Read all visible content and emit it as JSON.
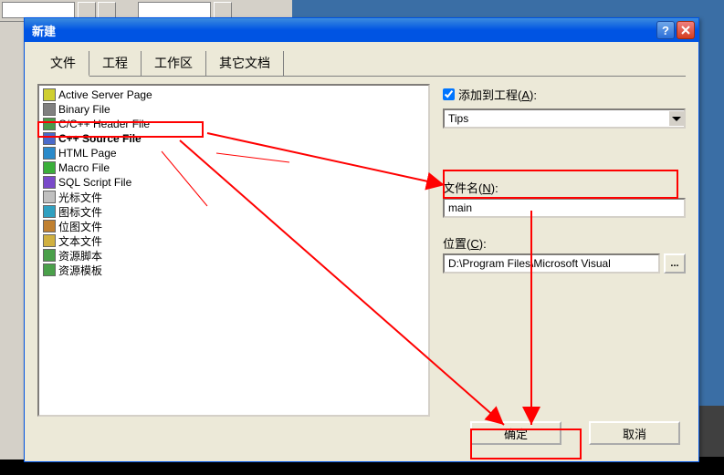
{
  "dialog": {
    "title": "新建",
    "tabs": [
      "文件",
      "工程",
      "工作区",
      "其它文档"
    ],
    "activeTab": 0
  },
  "filelist": [
    "Active Server Page",
    "Binary File",
    "C/C++ Header File",
    "C++ Source File",
    "HTML Page",
    "Macro File",
    "SQL Script File",
    "光标文件",
    "图标文件",
    "位图文件",
    "文本文件",
    "资源脚本",
    "资源模板"
  ],
  "selectedFileIndex": 3,
  "right": {
    "addToProject": {
      "label": "添加到工程",
      "hotkey": "A",
      "checked": true
    },
    "projectCombo": "Tips",
    "filenameLabel": "文件名",
    "filenameHotkey": "N",
    "filenameValue": "main",
    "locationLabel": "位置",
    "locationHotkey": "C",
    "locationValue": "D:\\Program Files\\Microsoft Visual",
    "browseLabel": "..."
  },
  "buttons": {
    "ok": "确定",
    "cancel": "取消"
  }
}
